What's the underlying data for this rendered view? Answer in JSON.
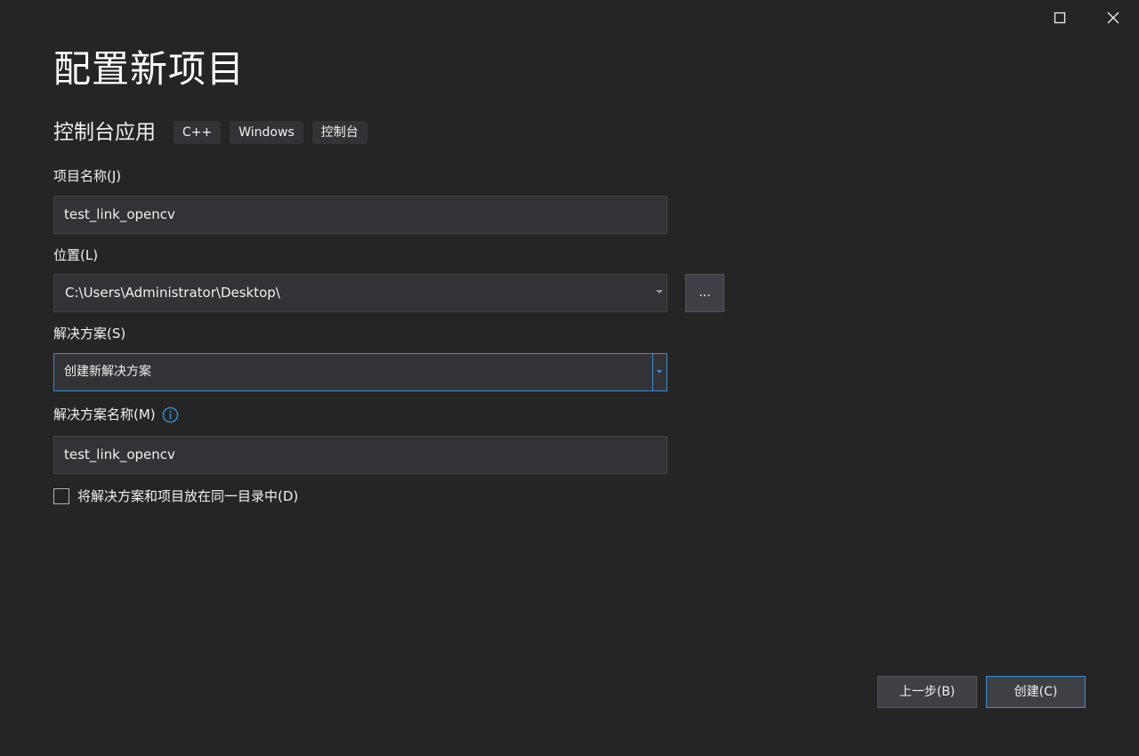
{
  "window": {
    "maximize_icon": "maximize-icon",
    "close_icon": "close-icon"
  },
  "page": {
    "title": "配置新项目",
    "template_name": "控制台应用",
    "tags": [
      "C++",
      "Windows",
      "控制台"
    ]
  },
  "form": {
    "project_name": {
      "label": "项目名称(J)",
      "value": "test_link_opencv"
    },
    "location": {
      "label": "位置(L)",
      "value": "C:\\Users\\Administrator\\Desktop\\",
      "browse_label": "..."
    },
    "solution": {
      "label": "解决方案(S)",
      "value": "创建新解决方案"
    },
    "solution_name": {
      "label": "解决方案名称(M)",
      "value": "test_link_opencv",
      "info_icon": "info-icon"
    },
    "same_directory": {
      "label": "将解决方案和项目放在同一目录中(D)",
      "checked": false
    }
  },
  "footer": {
    "back_label": "上一步(B)",
    "create_label": "创建(C)"
  },
  "colors": {
    "background": "#252526",
    "field_background": "#333337",
    "accent": "#3e8ed0",
    "text": "#f1f1f1"
  }
}
